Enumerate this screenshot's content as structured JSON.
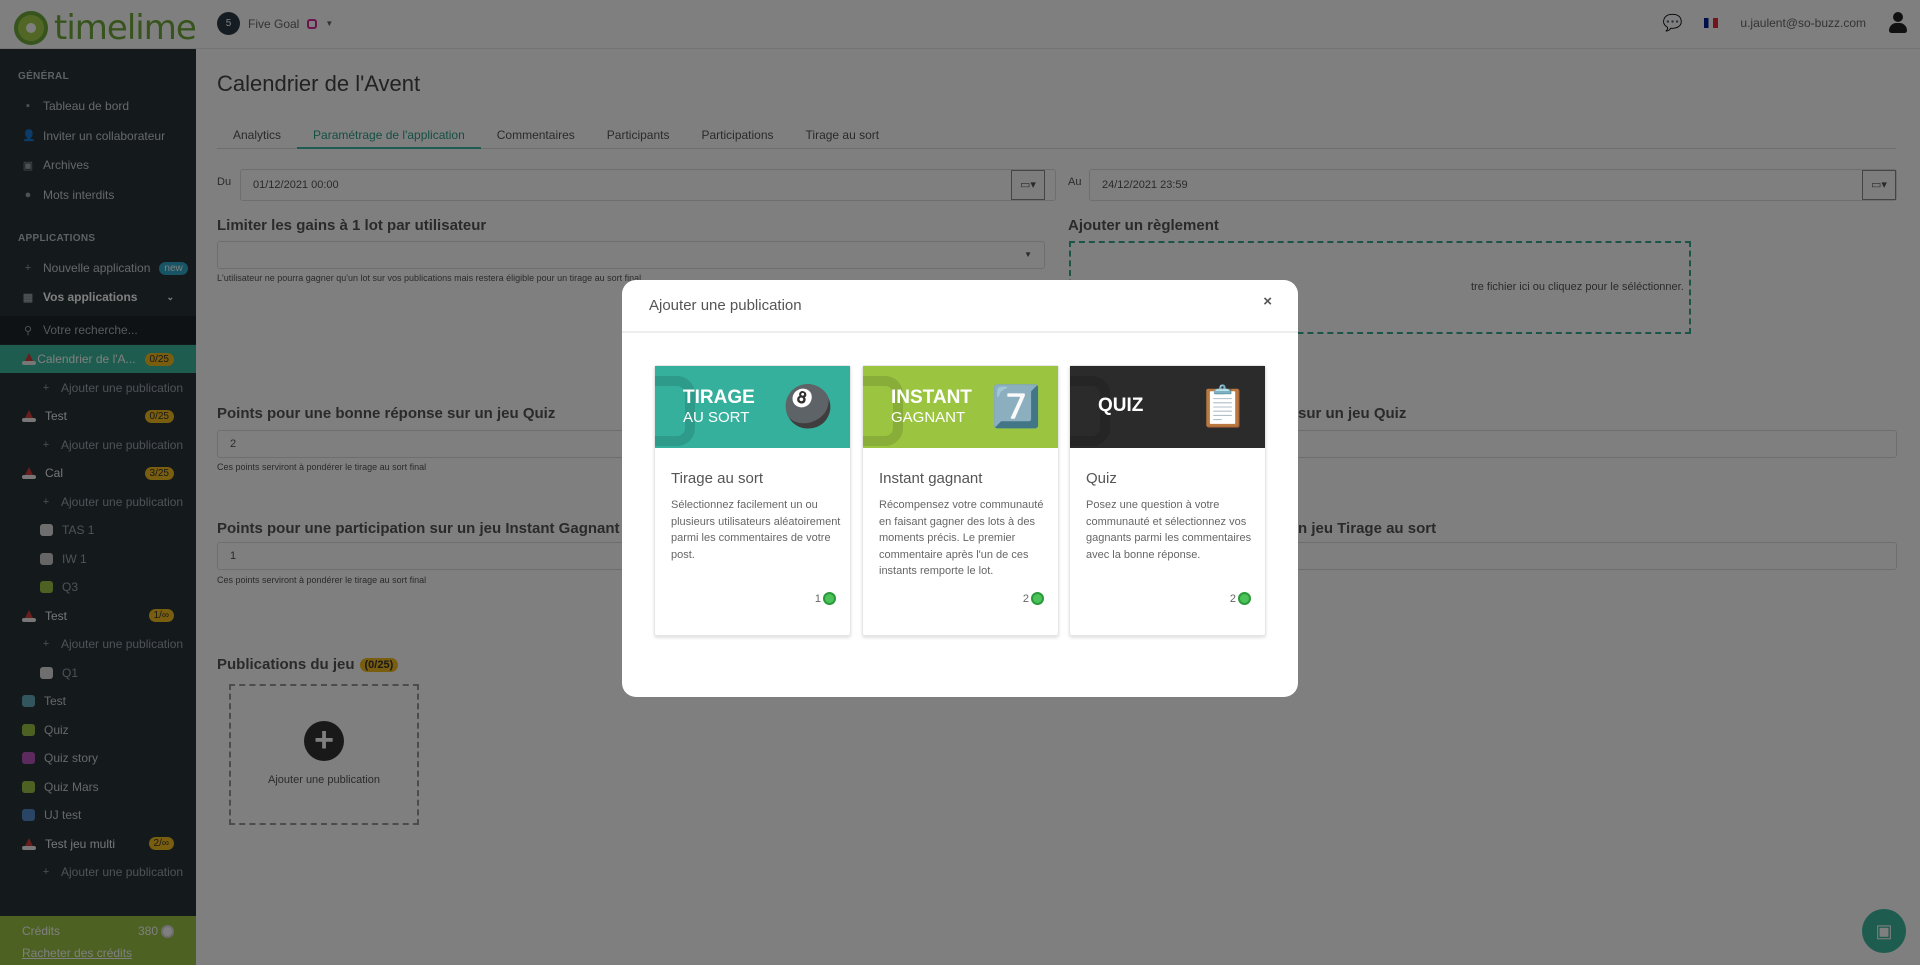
{
  "header": {
    "logo": "timelime",
    "account": "Five Goal",
    "user_email": "u.jaulent@so-buzz.com"
  },
  "sidebar": {
    "general_title": "GÉNÉRAL",
    "general": [
      {
        "label": "Tableau de bord",
        "icon": "dashboard-icon"
      },
      {
        "label": "Inviter un collaborateur",
        "icon": "user-plus-icon"
      },
      {
        "label": "Archives",
        "icon": "archive-icon"
      },
      {
        "label": "Mots interdits",
        "icon": "forbidden-words-icon"
      }
    ],
    "apps_title": "APPLICATIONS",
    "new_app": "Nouvelle application",
    "new_badge": "new",
    "your_apps": "Vos applications",
    "search_placeholder": "Votre recherche...",
    "apps": [
      {
        "label": "Calendrier de l'A...",
        "badge": "0/25",
        "type": "app",
        "active": true
      },
      {
        "label": "Ajouter une publication",
        "type": "add"
      },
      {
        "label": "Test",
        "badge": "0/25",
        "type": "app"
      },
      {
        "label": "Ajouter une publication",
        "type": "add"
      },
      {
        "label": "Cal",
        "badge": "3/25",
        "type": "app"
      },
      {
        "label": "Ajouter une publication",
        "type": "add"
      },
      {
        "label": "TAS 1",
        "type": "child"
      },
      {
        "label": "IW 1",
        "type": "child"
      },
      {
        "label": "Q3",
        "type": "child"
      },
      {
        "label": "Test",
        "badge": "1/∞",
        "type": "app"
      },
      {
        "label": "Ajouter une publication",
        "type": "add"
      },
      {
        "label": "Q1",
        "type": "child"
      },
      {
        "label": "Test",
        "type": "game"
      },
      {
        "label": "Quiz",
        "type": "game"
      },
      {
        "label": "Quiz story",
        "type": "game"
      },
      {
        "label": "Quiz Mars",
        "type": "game"
      },
      {
        "label": "UJ test",
        "type": "game"
      },
      {
        "label": "Test jeu multi",
        "badge": "2/∞",
        "type": "app"
      },
      {
        "label": "Ajouter une publication",
        "type": "add"
      }
    ],
    "credits_label": "Crédits",
    "credits_value": "380",
    "buy_credits": "Racheter des crédits"
  },
  "main": {
    "title": "Calendrier de l'Avent",
    "tabs": [
      "Analytics",
      "Paramétrage de l'application",
      "Commentaires",
      "Participants",
      "Participations",
      "Tirage au sort"
    ],
    "active_tab": 1,
    "from_label": "Du",
    "from_value": "01/12/2021 00:00",
    "to_label": "Au",
    "to_value": "24/12/2021 23:59",
    "limit_label": "Limiter les gains à 1 lot par utilisateur",
    "limit_help": "L'utilisateur ne pourra gagner qu'un lot sur vos publications mais restera éligible pour un tirage au sort final",
    "rules_label": "Ajouter un règlement",
    "rules_drop_visible": "tre fichier ici ou cliquez pour le séléctionner.",
    "quiz_points_label": "Points pour une bonne réponse sur un jeu Quiz",
    "quiz_points_value": "2",
    "points_help": "Ces points serviront à pondérer le tirage au sort final",
    "right_quiz_label_visible": "sur un jeu Quiz",
    "iw_points_label": "Points pour une participation sur un jeu Instant Gagnant",
    "iw_points_value": "1",
    "right_tas_label_visible": "n jeu Tirage au sort",
    "publications_label": "Publications du jeu",
    "publications_badge": "(0/25)",
    "add_publication": "Ajouter une publication"
  },
  "modal": {
    "title": "Ajouter une publication",
    "close": "×",
    "cards": [
      {
        "banner": "TIRAGE",
        "banner_sub": "AU SORT",
        "color": "#35b09c",
        "title": "Tirage au sort",
        "desc": "Sélectionnez facilement un ou plusieurs utilisateurs aléatoirement parmi les commentaires de votre post.",
        "cost": "1"
      },
      {
        "banner": "INSTANT",
        "banner_sub": "GAGNANT",
        "color": "#9bc541",
        "title": "Instant gagnant",
        "desc": "Récompensez votre communauté en faisant gagner des lots à des moments précis. Le premier commentaire après l'un de ces instants remporte le lot.",
        "cost": "2"
      },
      {
        "banner": "QUIZ",
        "banner_sub": "",
        "color": "#2b2b2b",
        "title": "Quiz",
        "desc": "Posez une question à votre communauté et sélectionnez vos gagnants parmi les commentaires avec la bonne réponse.",
        "cost": "2"
      }
    ]
  },
  "colors": {
    "accent": "#3ab89e",
    "badge": "#f4bc1e",
    "credits": "#9ac244",
    "sidebar": "#283238"
  }
}
